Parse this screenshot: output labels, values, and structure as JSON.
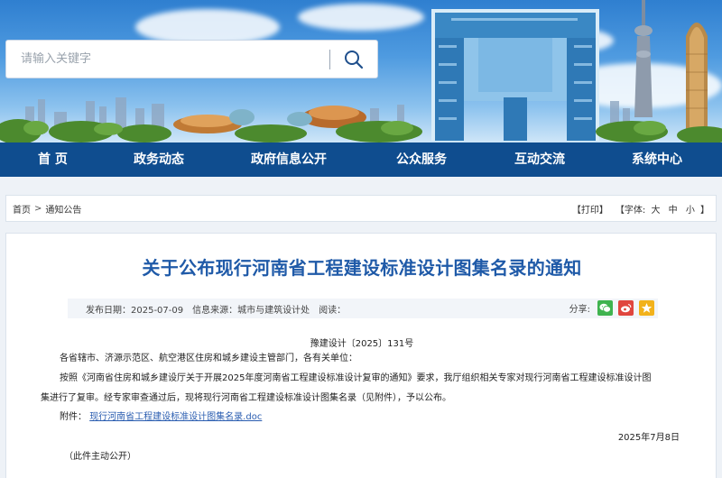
{
  "search": {
    "placeholder": "请输入关键字"
  },
  "nav": {
    "items": [
      "首 页",
      "政务动态",
      "政府信息公开",
      "公众服务",
      "互动交流",
      "系统中心"
    ]
  },
  "breadcrumb": {
    "home": "首页",
    "separator": ">",
    "section": "通知公告",
    "print": "【打印】",
    "font_label": "【字体:",
    "font_large": "大",
    "font_medium": "中",
    "font_small": "小",
    "font_end": "】"
  },
  "article": {
    "title": "关于公布现行河南省工程建设标准设计图集名录的通知",
    "publish_date": "发布日期：2025-07-09",
    "source": "信息来源：城市与建筑设计处",
    "reads": "阅读：",
    "share_label": "分享:",
    "doc_number": "豫建设计〔2025〕131号",
    "recipients": "各省辖市、济源示范区、航空港区住房和城乡建设主管部门，各有关单位：",
    "body_line1": "按照《河南省住房和城乡建设厅关于开展2025年度河南省工程建设标准设计复审的通知》要求，我厅组织相关专家对现行河南省工程建设标准设计图",
    "body_line2": "集进行了复审。经专家审查通过后，现将现行河南省工程建设标准设计图集名录（见附件），予以公布。",
    "attachment_label": "附件：",
    "attachment_link": "现行河南省工程建设标准设计图集名录.doc",
    "sign_date": "2025年7月8日",
    "disclosure": "（此件主动公开）"
  },
  "colors": {
    "nav_bg": "#0f4d8f",
    "title": "#1f5aa8",
    "link": "#2a5db0",
    "wechat": "#3fb34f",
    "weibo": "#e0463e",
    "qzone": "#f2b21b"
  },
  "icons": [
    "search-icon",
    "wechat-icon",
    "weibo-icon",
    "qzone-icon"
  ]
}
